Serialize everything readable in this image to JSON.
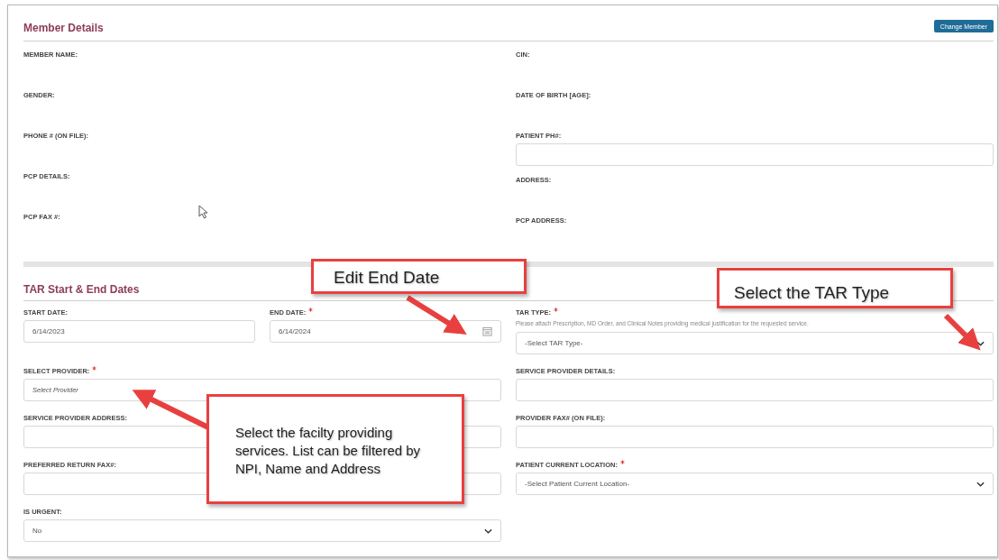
{
  "member_details": {
    "title": "Member Details",
    "button": "Change Member",
    "left": [
      {
        "label": "MEMBER NAME:",
        "kind": "text"
      },
      {
        "label": "GENDER:",
        "kind": "text"
      },
      {
        "label": "PHONE # (ON FILE):",
        "kind": "text"
      },
      {
        "label": "PCP DETAILS:",
        "kind": "text"
      },
      {
        "label": "PCP FAX #:",
        "kind": "text"
      }
    ],
    "right": [
      {
        "label": "CIN:",
        "kind": "text"
      },
      {
        "label": "DATE OF BIRTH [AGE]:",
        "kind": "text"
      },
      {
        "label": "PATIENT PH#:",
        "kind": "input"
      },
      {
        "label": "ADDRESS:",
        "kind": "text"
      },
      {
        "label": "PCP ADDRESS:",
        "kind": "text"
      }
    ]
  },
  "tar_dates": {
    "title": "TAR Start & End Dates",
    "fields": [
      {
        "kind": "group",
        "fields": [
          {
            "label": "START DATE:",
            "required": false,
            "kind": "input",
            "value": "6/14/2023"
          },
          {
            "label": "END DATE:",
            "required": true,
            "kind": "date",
            "value": "6/14/2024"
          }
        ]
      },
      {
        "label": "TAR TYPE:",
        "required": true,
        "kind": "select",
        "hint": "Please attach Prescription, MD Order, and Clinical Notes providing medical justification for the requested service.",
        "value": "-Select TAR Type-"
      },
      {
        "label": "SELECT PROVIDER:",
        "required": true,
        "kind": "input",
        "placeholder": "Select Provider"
      },
      {
        "label": "SERVICE PROVIDER DETAILS:",
        "required": false,
        "kind": "input"
      },
      {
        "label": "SERVICE PROVIDER ADDRESS:",
        "required": false,
        "kind": "input"
      },
      {
        "label": "PROVIDER FAX# (ON FILE):",
        "required": false,
        "kind": "input"
      },
      {
        "label": "PREFERRED RETURN FAX#:",
        "required": false,
        "kind": "input"
      },
      {
        "label": "PATIENT CURRENT LOCATION:",
        "required": true,
        "kind": "select",
        "value": "-Select Patient Current Location-"
      },
      {
        "label": "IS URGENT:",
        "required": false,
        "kind": "select",
        "value": "No"
      }
    ]
  },
  "annotations": [
    {
      "text": "Edit End Date"
    },
    {
      "text": "Select the TAR Type"
    },
    {
      "text": "Select the facilty providing services. List can be filtered by NPI, Name and Address"
    }
  ]
}
